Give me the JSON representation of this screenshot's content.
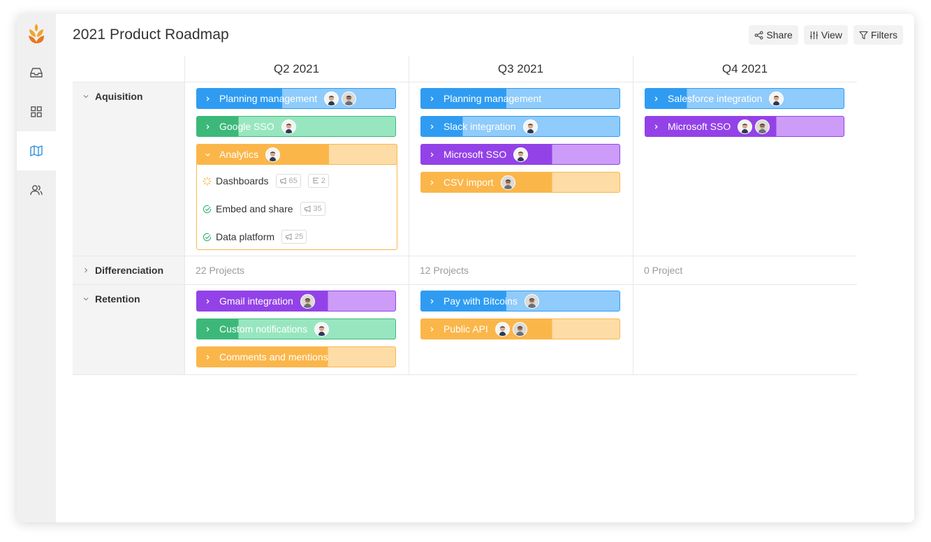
{
  "title": "2021 Product Roadmap",
  "toolbar": {
    "share": "Share",
    "view": "View",
    "filters": "Filters"
  },
  "sidebar": {
    "icons": [
      "logo-icon",
      "inbox-icon",
      "grid-icon",
      "map-icon",
      "users-icon"
    ],
    "active": "map-icon"
  },
  "columns": [
    "Q2 2021",
    "Q3 2021",
    "Q4 2021"
  ],
  "groups": {
    "aquisition": {
      "label": "Aquisition",
      "q2": {
        "planning": "Planning management",
        "google_sso": "Google SSO",
        "analytics": {
          "label": "Analytics",
          "items": [
            {
              "label": "Dashboards",
              "votes": "65",
              "links": "2"
            },
            {
              "label": "Embed and share",
              "votes": "35"
            },
            {
              "label": "Data platform",
              "votes": "25"
            }
          ]
        }
      },
      "q3": {
        "planning": "Planning management",
        "slack": "Slack integration",
        "microsoft_sso": "Microsoft SSO",
        "csv": "CSV import"
      },
      "q4": {
        "salesforce": "Salesforce integration",
        "microsoft_sso": "Microsoft SSO"
      }
    },
    "differenciation": {
      "label": "Differenciation",
      "counts": [
        "22 Projects",
        "12 Projects",
        "0 Project"
      ]
    },
    "retention": {
      "label": "Retention",
      "q2": {
        "gmail": "Gmail integration",
        "notifications": "Custom notifications",
        "comments": "Comments and mentions"
      },
      "q3": {
        "bitcoins": "Pay with Bitcoins",
        "public_api": "Public API"
      }
    }
  },
  "progress": {
    "aquisition.q2.planning": 0.43,
    "aquisition.q2.google_sso": 0.21,
    "aquisition.q2.analytics": 0.66,
    "aquisition.q3.planning": 0.43,
    "aquisition.q3.slack": 0.21,
    "aquisition.q3.microsoft_sso": 0.66,
    "aquisition.q3.csv": 0.66,
    "aquisition.q4.salesforce": 0.21,
    "aquisition.q4.microsoft_sso": 0.66,
    "retention.q2.gmail": 0.66,
    "retention.q2.notifications": 0.21,
    "retention.q2.comments": 0.66,
    "retention.q3.bitcoins": 0.43,
    "retention.q3.public_api": 0.66
  },
  "colors": {
    "blue": "#2f9cf2",
    "green": "#3cb979",
    "purple": "#9342e8",
    "orange": "#fbb64a",
    "sidebar_active": "#2f8fd8"
  }
}
